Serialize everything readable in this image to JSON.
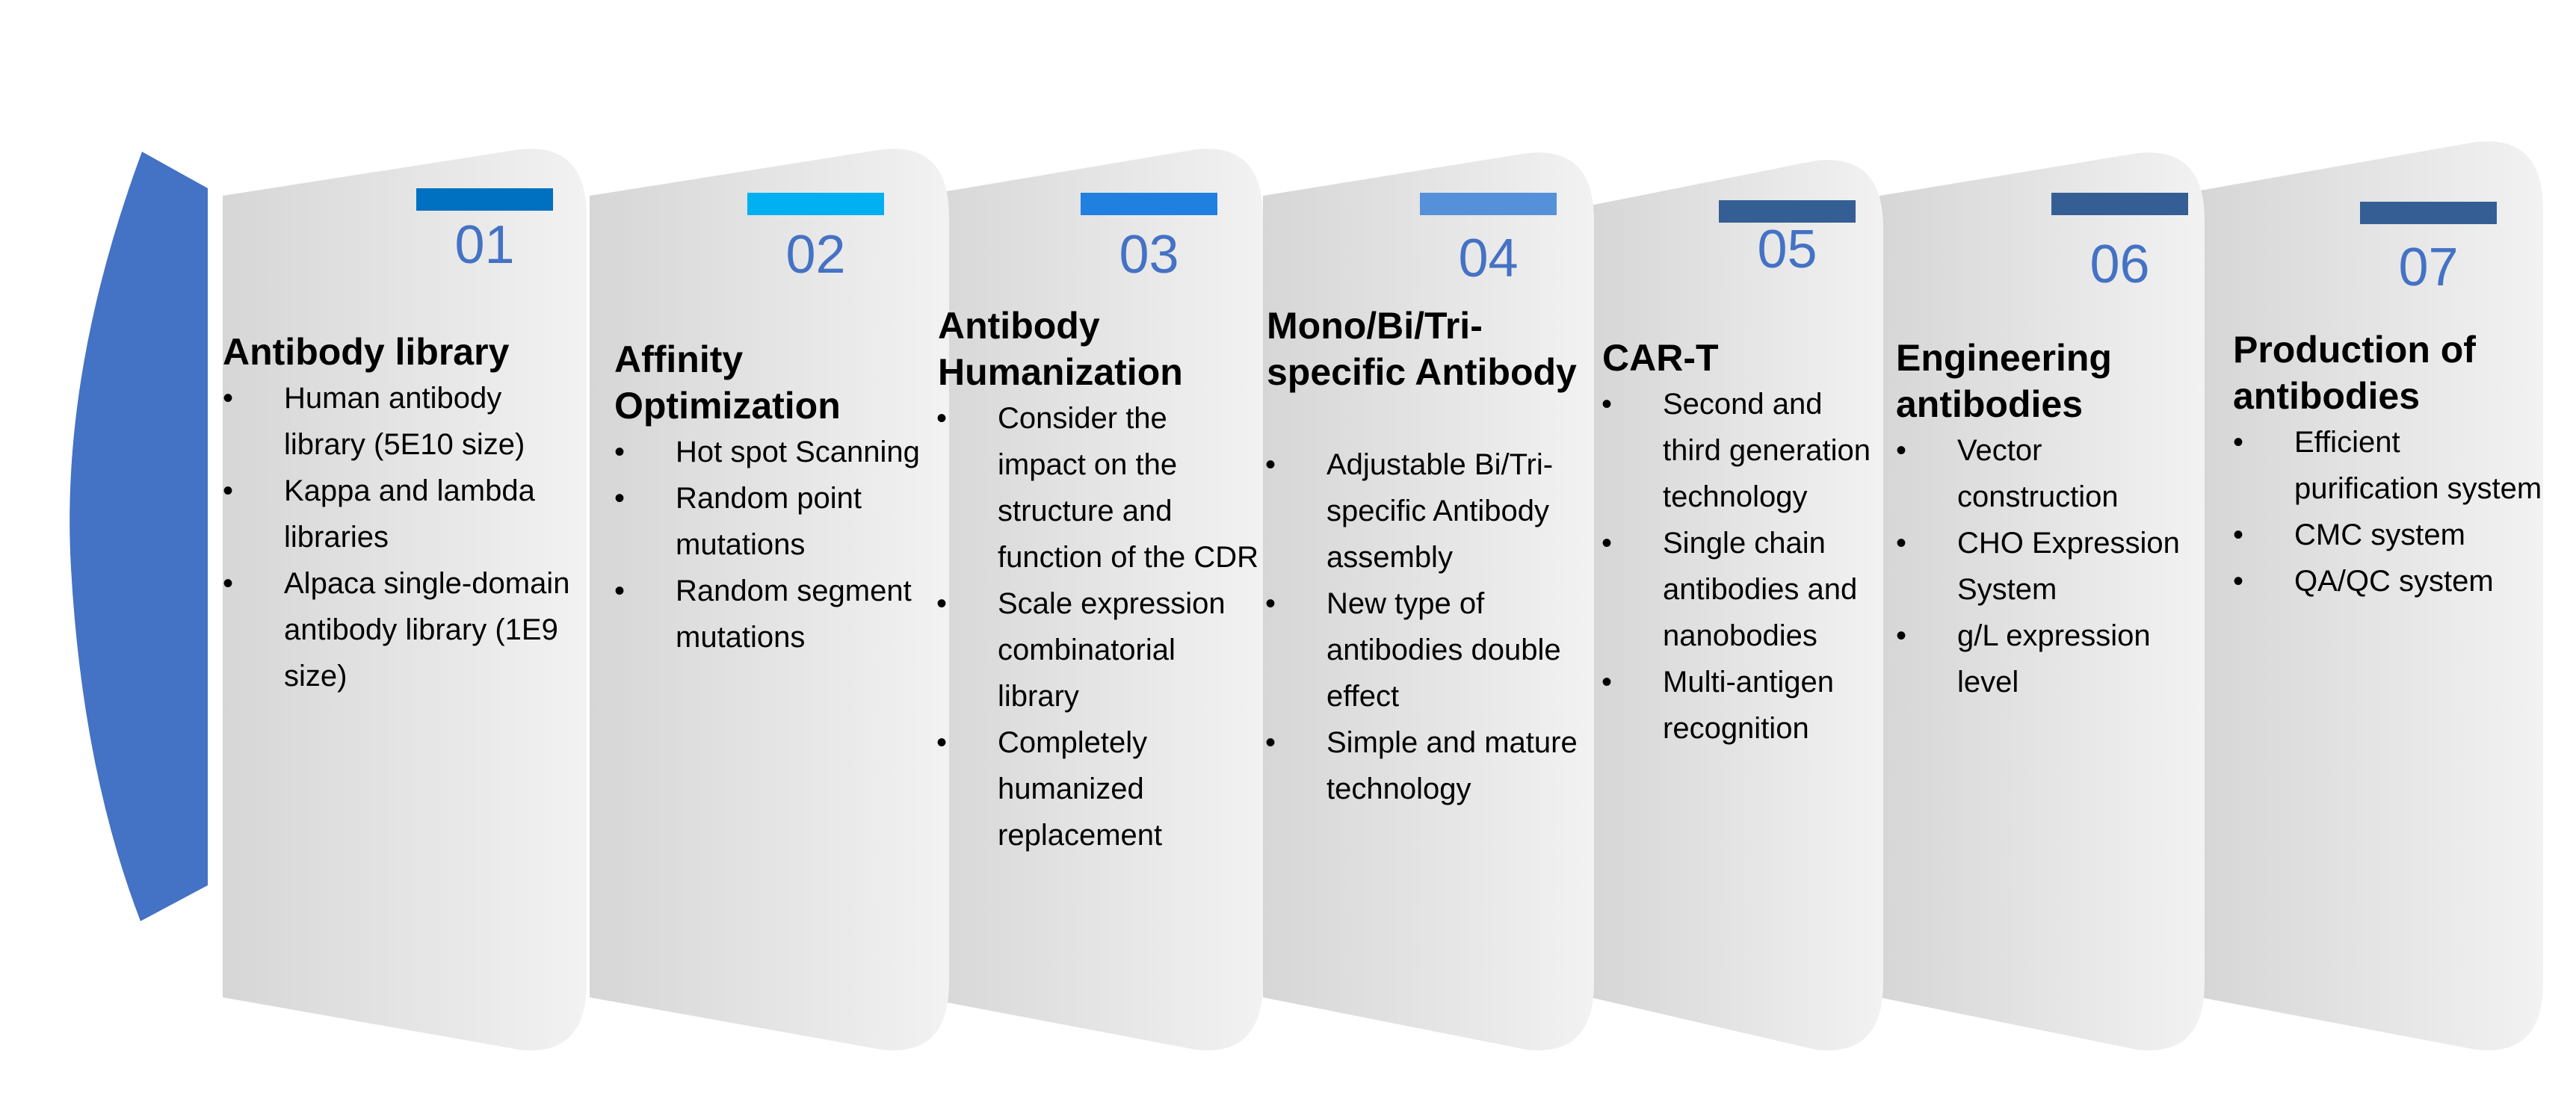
{
  "colors": {
    "arc": "#4472c4",
    "number": "#4472c4",
    "panel_dark": "#d6d6d6",
    "panel_light": "#f2f2f2"
  },
  "panels": [
    {
      "number": "01",
      "bar_color": "#0070c0",
      "title": "Antibody library",
      "items": [
        "Human antibody library (5E10 size)",
        "Kappa and lambda libraries",
        "Alpaca single-domain antibody library (1E9 size)"
      ]
    },
    {
      "number": "02",
      "bar_color": "#00b0f0",
      "title": "Affinity Optimization",
      "items": [
        "Hot spot Scanning",
        "Random point mutations",
        "Random segment mutations"
      ]
    },
    {
      "number": "03",
      "bar_color": "#1f80e0",
      "title": "Antibody Humanization",
      "items": [
        "Consider the impact on the structure and function of the CDR",
        "Scale expression combinatorial library",
        "Completely humanized replacement"
      ]
    },
    {
      "number": "04",
      "bar_color": "#5591d9",
      "title": "Mono/Bi/Tri-specific Antibody",
      "items": [
        "Adjustable Bi/Tri-specific Antibody assembly",
        "New type of antibodies double effect",
        "Simple and mature technology"
      ]
    },
    {
      "number": "05",
      "bar_color": "#355f94",
      "title": "CAR-T",
      "items": [
        "Second and third generation technology",
        "Single chain antibodies and nanobodies",
        "Multi-antigen recognition"
      ]
    },
    {
      "number": "06",
      "bar_color": "#355f94",
      "title": "Engineering antibodies",
      "items": [
        "Vector construction",
        "CHO Expression System",
        "g/L expression level"
      ]
    },
    {
      "number": "07",
      "bar_color": "#355f94",
      "title": "Production of antibodies",
      "items": [
        "Efficient purification system",
        "CMC system",
        "QA/QC system"
      ]
    }
  ]
}
